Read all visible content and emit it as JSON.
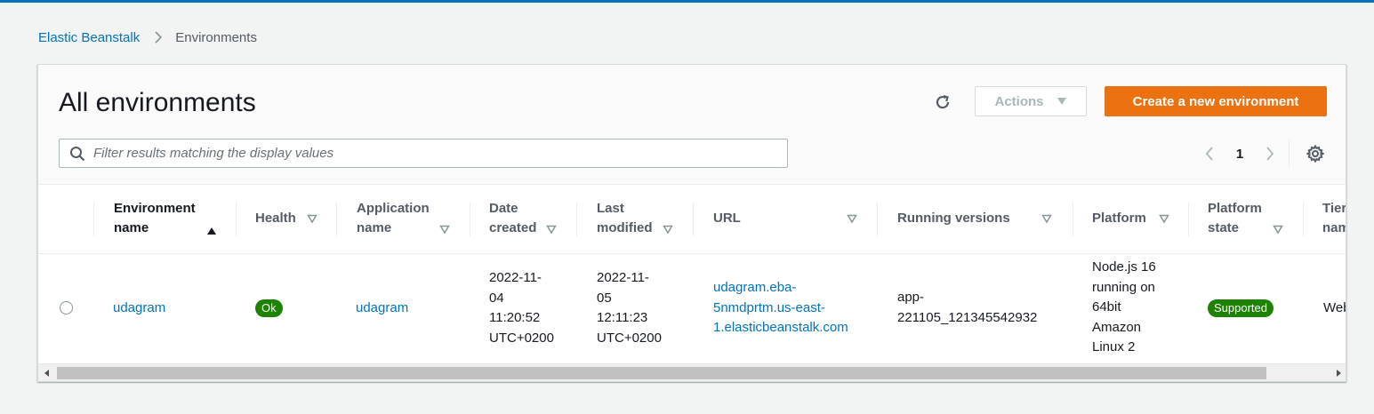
{
  "breadcrumb": {
    "parent": "Elastic Beanstalk",
    "current": "Environments"
  },
  "header": {
    "title": "All environments",
    "actions_label": "Actions",
    "create_label": "Create a new environment"
  },
  "filter": {
    "placeholder": "Filter results matching the display values",
    "value": ""
  },
  "pagination": {
    "current_page": "1"
  },
  "table": {
    "columns": [
      {
        "line1": "Environment",
        "line2": "name",
        "sorted": "ascending"
      },
      {
        "line1": "Health",
        "line2": ""
      },
      {
        "line1": "Application",
        "line2": "name"
      },
      {
        "line1": "Date",
        "line2": "created"
      },
      {
        "line1": "Last",
        "line2": "modified"
      },
      {
        "line1": "URL",
        "line2": ""
      },
      {
        "line1": "Running versions",
        "line2": ""
      },
      {
        "line1": "Platform",
        "line2": ""
      },
      {
        "line1": "Platform",
        "line2": "state"
      },
      {
        "line1": "Tier",
        "line2": "name"
      }
    ],
    "rows": [
      {
        "environment_name": "udagram",
        "health": "Ok",
        "application_name": "udagram",
        "date_created": [
          "2022-11-",
          "04",
          "11:20:52",
          "UTC+0200"
        ],
        "last_modified": [
          "2022-11-",
          "05",
          "12:11:23",
          "UTC+0200"
        ],
        "url": [
          "udagram.eba-",
          "5nmdprtm.us-east-",
          "1.elasticbeanstalk.com"
        ],
        "running_versions": [
          "app-",
          "221105_121345542932"
        ],
        "platform": [
          "Node.js 16",
          "running on",
          "64bit",
          "Amazon",
          "Linux 2"
        ],
        "platform_state": "Supported",
        "tier_name": "WebServer"
      }
    ]
  },
  "colors": {
    "link": "#0073bb",
    "primary_button": "#ec7211",
    "status_ok": "#1d8102",
    "top_bar": "#0073bb"
  }
}
